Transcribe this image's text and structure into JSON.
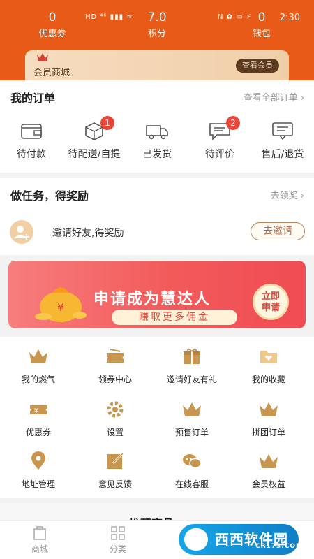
{
  "status_bar": {
    "left_icons": "HD ⁴⁶ ▮▮▮ ≈",
    "right_icons": "N ✿ ▭ ⚡",
    "time": "2:30"
  },
  "header": {
    "stats": [
      {
        "value": "0",
        "label": "优惠券"
      },
      {
        "value": "7.0",
        "label": "积分"
      },
      {
        "value": "0",
        "label": "钱包"
      }
    ],
    "vip": {
      "label": "会员商城",
      "button": "查看会员"
    }
  },
  "orders": {
    "title": "我的订单",
    "more": "查看全部订单 ›",
    "items": [
      {
        "label": "待付款",
        "icon": "wallet-icon",
        "badge": ""
      },
      {
        "label": "待配送/自提",
        "icon": "box-icon",
        "badge": "1"
      },
      {
        "label": "已发货",
        "icon": "truck-icon",
        "badge": ""
      },
      {
        "label": "待评价",
        "icon": "comment-icon",
        "badge": "2"
      },
      {
        "label": "售后/退货",
        "icon": "message-icon",
        "badge": ""
      }
    ]
  },
  "tasks": {
    "title": "做任务，得奖励",
    "more": "去领奖 ›",
    "invite_text": "邀请好友,得奖励",
    "invite_button": "去邀请"
  },
  "banner": {
    "title": "申请成为慧达人",
    "subtitle": "赚取更多佣金",
    "button_line1": "立即",
    "button_line2": "申请"
  },
  "grid": [
    {
      "label": "我的燃气",
      "icon": "crown-icon"
    },
    {
      "label": "领券中心",
      "icon": "coupon-icon"
    },
    {
      "label": "邀请好友有礼",
      "icon": "gift-icon"
    },
    {
      "label": "我的收藏",
      "icon": "folder-heart-icon"
    },
    {
      "label": "优惠券",
      "icon": "yen-ticket-icon"
    },
    {
      "label": "设置",
      "icon": "gear-icon"
    },
    {
      "label": "预售订单",
      "icon": "crown-icon"
    },
    {
      "label": "拼团订单",
      "icon": "crown-icon"
    },
    {
      "label": "地址管理",
      "icon": "location-icon"
    },
    {
      "label": "意见反馈",
      "icon": "edit-icon"
    },
    {
      "label": "在线客服",
      "icon": "chat-icon"
    },
    {
      "label": "会员权益",
      "icon": "crown-icon"
    }
  ],
  "recommend_title": "推荐商品",
  "tabbar": [
    {
      "label": "商城",
      "icon": "bag-icon"
    },
    {
      "label": "分类",
      "icon": "grid-icon"
    }
  ],
  "watermark": {
    "text": "西西软件园",
    "domain": "CR173.COM"
  },
  "colors": {
    "accent": "#e85a17",
    "gold": "#c8964e",
    "badge": "#e8463a"
  }
}
